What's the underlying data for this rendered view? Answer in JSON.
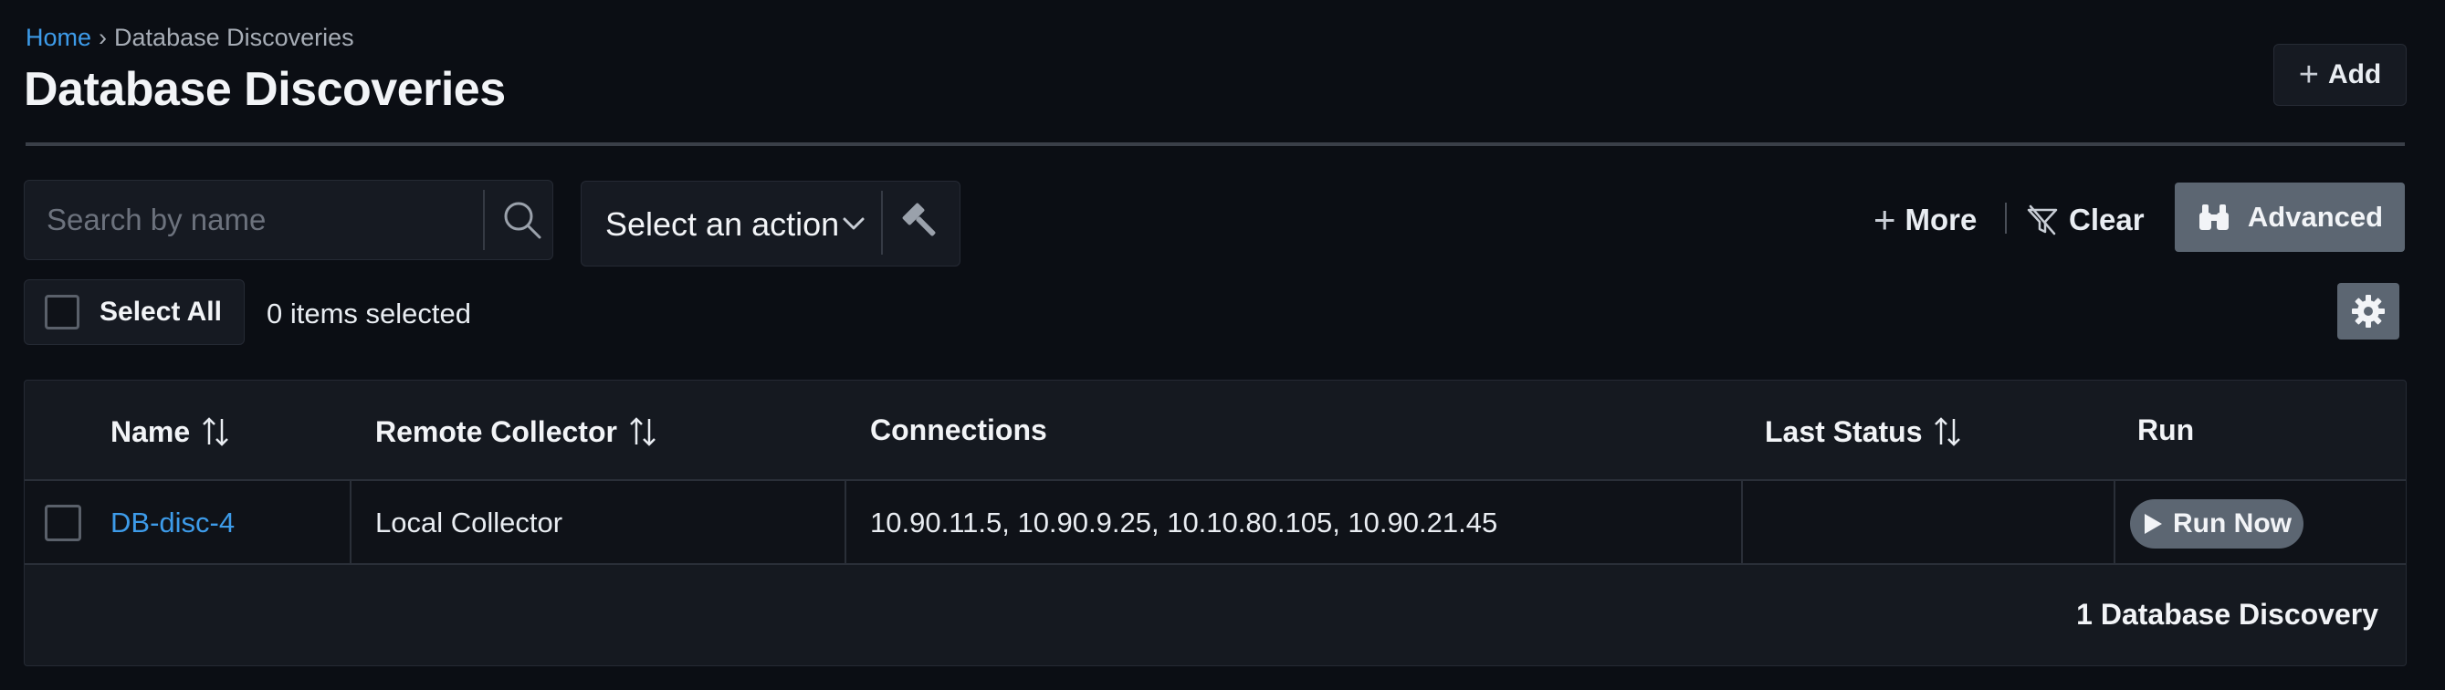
{
  "breadcrumb": {
    "home": "Home",
    "separator": "›",
    "current": "Database Discoveries"
  },
  "page": {
    "title": "Database Discoveries",
    "add_label": "Add"
  },
  "search": {
    "placeholder": "Search by name",
    "value": ""
  },
  "action": {
    "selected": "Select an action"
  },
  "toolbar": {
    "more_label": "More",
    "clear_label": "Clear",
    "advanced_label": "Advanced"
  },
  "selection": {
    "select_all_label": "Select All",
    "status": "0 items selected"
  },
  "table": {
    "columns": [
      {
        "label": "Name",
        "sortable": true
      },
      {
        "label": "Remote Collector",
        "sortable": true
      },
      {
        "label": "Connections",
        "sortable": false
      },
      {
        "label": "Last Status",
        "sortable": true
      },
      {
        "label": "Run",
        "sortable": false
      }
    ],
    "rows": [
      {
        "name": "DB-disc-4",
        "remote_collector": "Local Collector",
        "connections": "10.90.11.5, 10.90.9.25, 10.10.80.105, 10.90.21.45",
        "last_status": "",
        "run_label": "Run Now"
      }
    ],
    "footer": "1 Database Discovery"
  },
  "colors": {
    "accent_link": "#3d9be9",
    "background": "#0b0e14",
    "button_gray": "#5c6672"
  },
  "icons": [
    "search-icon",
    "chevron-down-icon",
    "hammer-icon",
    "plus-icon",
    "filter-clear-icon",
    "binoculars-icon",
    "gear-icon",
    "sort-icon",
    "play-icon"
  ]
}
